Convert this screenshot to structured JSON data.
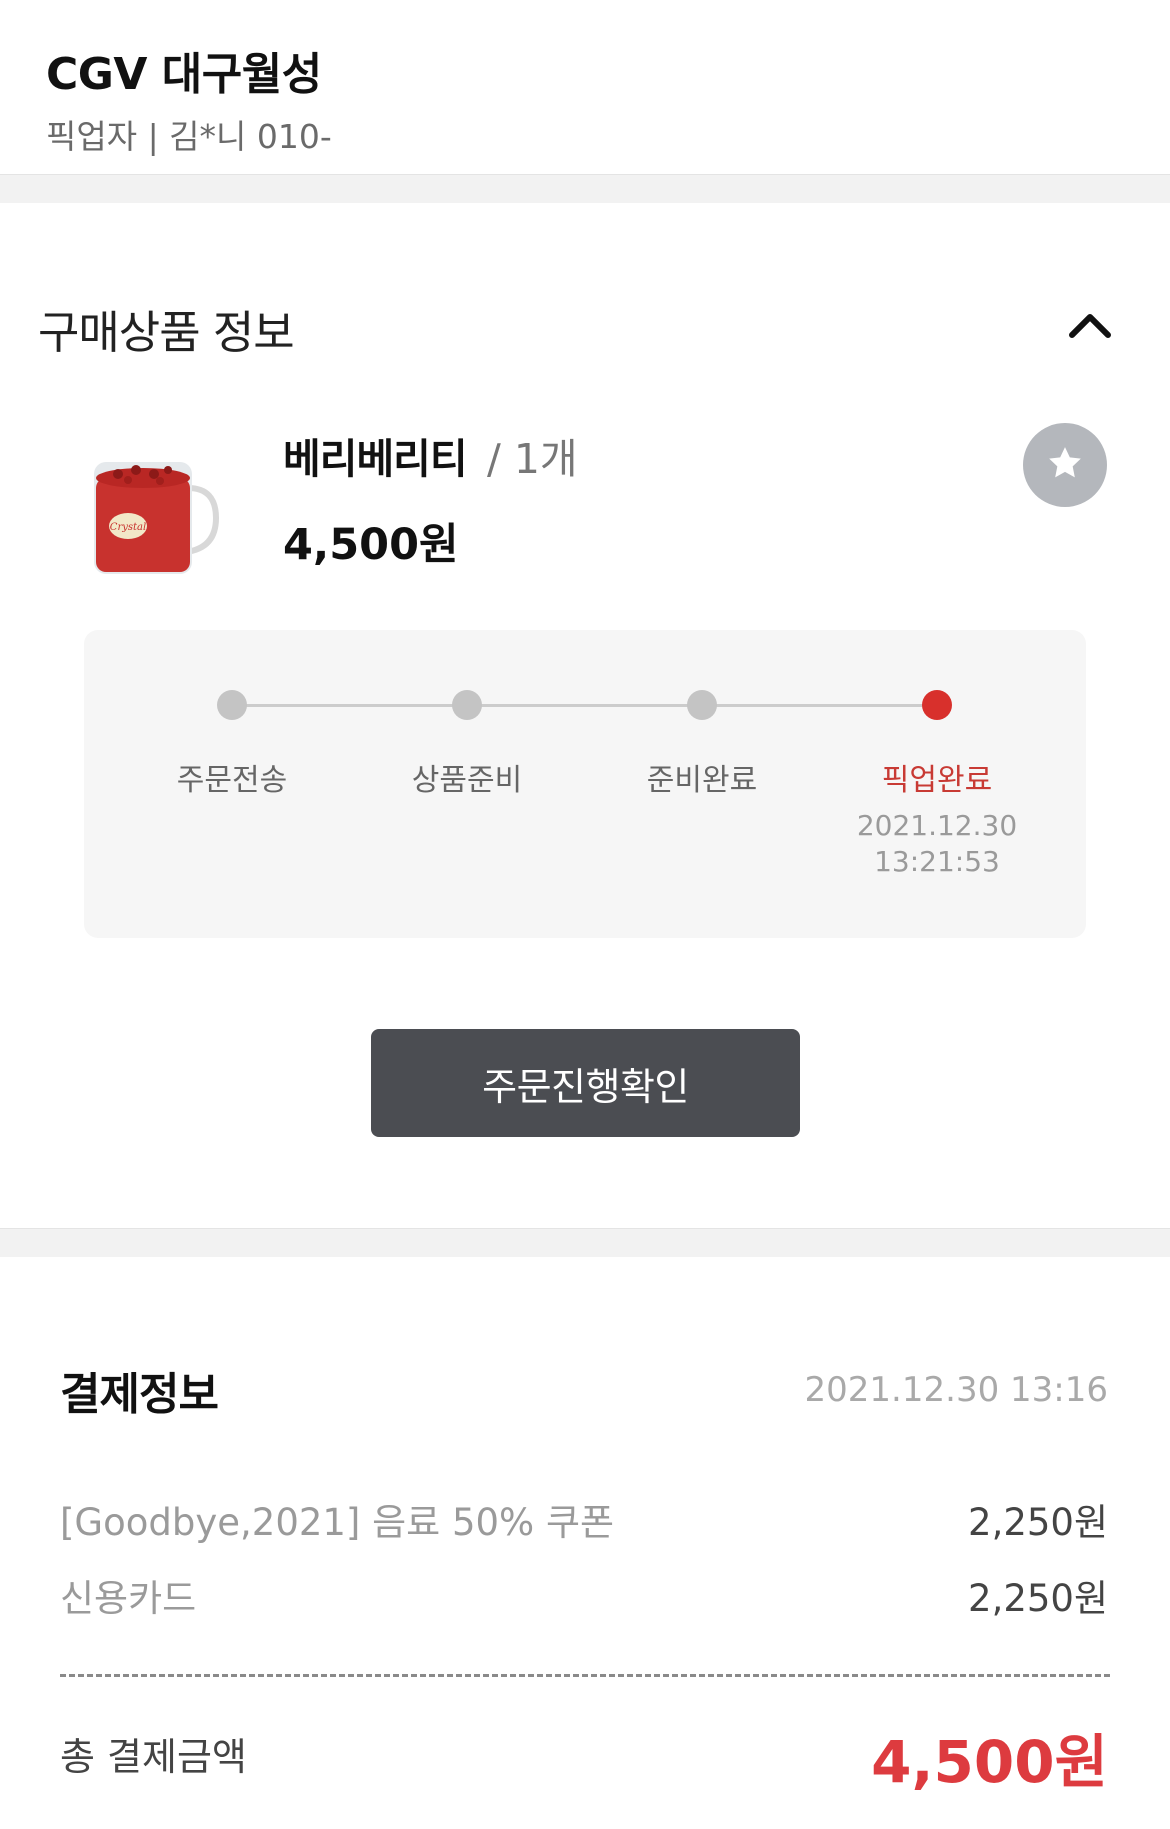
{
  "header": {
    "store_name": "CGV 대구월성",
    "pickup_info": "픽업자 | 김*니 010-"
  },
  "product_section": {
    "title": "구매상품 정보",
    "item": {
      "name": "베리베리티",
      "quantity": "/ 1개",
      "price": "4,500원"
    },
    "progress": {
      "steps": [
        {
          "label": "주문전송",
          "active": false
        },
        {
          "label": "상품준비",
          "active": false
        },
        {
          "label": "준비완료",
          "active": false
        },
        {
          "label": "픽업완료",
          "active": true
        }
      ],
      "completed_date": "2021.12.30",
      "completed_time": "13:21:53"
    },
    "order_button_label": "주문진행확인"
  },
  "payment": {
    "title": "결제정보",
    "date": "2021.12.30 13:16",
    "rows": [
      {
        "label": "[Goodbye,2021] 음료 50% 쿠폰",
        "value": "2,250원"
      },
      {
        "label": "신용카드",
        "value": "2,250원"
      }
    ],
    "total_label": "총 결제금액",
    "total_value": "4,500원"
  },
  "colors": {
    "accent": "#dd3b3f",
    "active_step": "#d8302c",
    "button": "#4b4d52"
  },
  "icons": [
    "chevron-up-icon",
    "star-icon"
  ]
}
